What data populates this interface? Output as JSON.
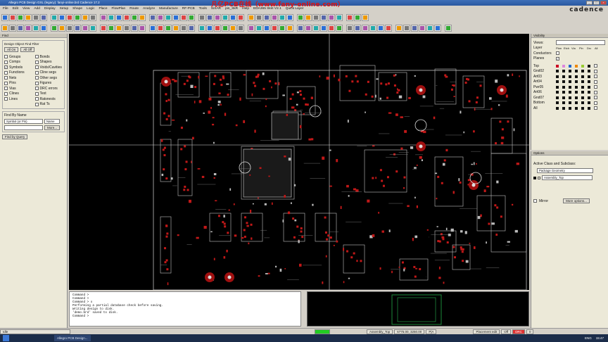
{
  "window": {
    "title": "Allegro PCB Design GXL (legacy): fanyi-online.brd  Cadence 17.2"
  },
  "watermark": "凡亿PCB在线（www.fany-online.com）",
  "brand": "cadence",
  "menu": [
    "File",
    "Edit",
    "View",
    "Add",
    "Display",
    "Setup",
    "Shape",
    "Logic",
    "Place",
    "FlowPlan",
    "Route",
    "Analyze",
    "Manufacture",
    "RF-PCB",
    "Tools",
    "SiXAR",
    "pin_SkR",
    "Help",
    "EDA365 SkiII V2.1",
    "Quick Layer"
  ],
  "find": {
    "title": "Find",
    "filter_title": "Design Object Find Filter",
    "all_on": "All On",
    "all_off": "All Off",
    "items_left": [
      {
        "label": "Groups",
        "checked": false
      },
      {
        "label": "Comps",
        "checked": false
      },
      {
        "label": "Symbols",
        "checked": true
      },
      {
        "label": "Functions",
        "checked": false
      },
      {
        "label": "Nets",
        "checked": false
      },
      {
        "label": "Pins",
        "checked": false
      },
      {
        "label": "Vias",
        "checked": false
      },
      {
        "label": "Clines",
        "checked": false
      },
      {
        "label": "Lines",
        "checked": false
      }
    ],
    "items_right": [
      {
        "label": "Bonds",
        "checked": false
      },
      {
        "label": "Shapes",
        "checked": false
      },
      {
        "label": "Voids/Cavities",
        "checked": false
      },
      {
        "label": "Cline segs",
        "checked": false
      },
      {
        "label": "Other segs",
        "checked": false
      },
      {
        "label": "Figures",
        "checked": false
      },
      {
        "label": "DRC errors",
        "checked": false
      },
      {
        "label": "Text",
        "checked": false
      },
      {
        "label": "Ratsnests",
        "checked": false
      },
      {
        "label": "Rat Ts",
        "checked": false
      }
    ],
    "find_by_name": "Find By Name",
    "name_type": "Symbol (or Pin)",
    "name_mode": "Name",
    "more": "More...",
    "find_by_query": "Find by Query"
  },
  "command": {
    "lines": [
      "Command >",
      "Command >",
      "Command > x",
      "Performing a partial database check before saving.",
      "Writing design to disk.",
      "'demo.brd' saved to disk.",
      "Command >"
    ]
  },
  "visibility": {
    "title": "Visibility",
    "views_label": "Views:",
    "layer_label": "Layer",
    "columns": [
      "Plan",
      "Etch",
      "Via",
      "Pin",
      "Drc",
      "All"
    ],
    "conductors": "Conductors",
    "planes": "Planes",
    "layers": [
      "Top",
      "Gnd02",
      "Art03",
      "Art04",
      "Pwr05",
      "Art06",
      "Gnd07",
      "Bottom",
      "All"
    ]
  },
  "options": {
    "title": "Options",
    "active_class_label": "Active Class and Subclass:",
    "active_class": "Package Geometry",
    "active_subclass": "Assembly_Top",
    "mirror_label": "Mirror",
    "more_options": "More options..."
  },
  "status": {
    "mode": "Idle",
    "layer": "Assembly_Top",
    "coords": "6775.00, 3250.00",
    "units": "P|A",
    "placement": "Placement edit",
    "off": "Off",
    "drc": "DRC",
    "zero": "0"
  },
  "taskbar": {
    "tasks": [
      "Allegro PCB Design..."
    ],
    "lang": "ENG",
    "time": "15:47"
  },
  "colors": {
    "canvas": "#000000",
    "trace": "#c0c0c0",
    "pad": "#c01818",
    "accent": "#e01010",
    "progress": "#22cc22"
  }
}
